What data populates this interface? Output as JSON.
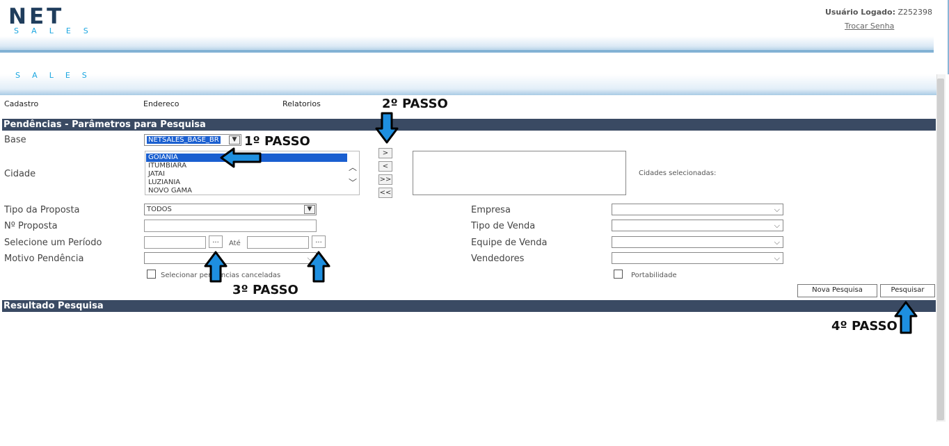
{
  "header": {
    "logo_top": "NET",
    "logo_bottom": "SALES",
    "user_label": "Usuário Logado:",
    "user_id": "Z252398",
    "change_password": "Trocar Senha",
    "ghost_sales": "SALES"
  },
  "menu": [
    "Cadastro",
    "Endereco",
    "Relatorios"
  ],
  "params_section": {
    "title": "Pendências - Parâmetros para Pesquisa",
    "base_label": "Base",
    "base_value": "NETSALES_BASE_BR",
    "city_label": "Cidade",
    "cities": [
      "GOIANIA",
      "ITUMBIARA",
      "JATAI",
      "LUZIANIA",
      "NOVO GAMA"
    ],
    "selected_city": "GOIANIA",
    "move_buttons": [
      ">",
      "<",
      ">>",
      "<<"
    ],
    "selected_cities_label": "Cidades selecionadas:",
    "proposal_type_label": "Tipo da Proposta",
    "proposal_type_value": "TODOS",
    "proposal_number_label": "Nº Proposta",
    "period_label": "Selecione um Período",
    "until_label": "Até",
    "picker_button": "...",
    "reason_label": "Motivo Pendência",
    "cancelled_label": "Selecionar pendências canceladas",
    "company_label": "Empresa",
    "sale_type_label": "Tipo de Venda",
    "sales_team_label": "Equipe de Venda",
    "sellers_label": "Vendedores",
    "portability_label": "Portabilidade",
    "new_search_button": "Nova Pesquisa",
    "search_button": "Pesquisar"
  },
  "results_section": {
    "title": "Resultado Pesquisa"
  },
  "annotations": {
    "step1": "1º PASSO",
    "step2": "2º PASSO",
    "step3": "3º PASSO",
    "step4": "4º PASSO",
    "arrow_color": "#1e8fe0"
  }
}
